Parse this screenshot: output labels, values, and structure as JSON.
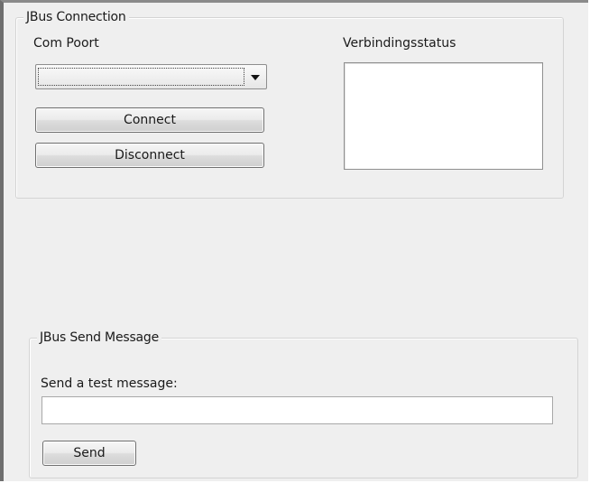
{
  "connection_group": {
    "title": "JBus Connection",
    "com_port_label": "Com Poort",
    "com_port_selected": "",
    "connect_label": "Connect",
    "disconnect_label": "Disconnect",
    "status_label": "Verbindingsstatus",
    "status_items": []
  },
  "send_group": {
    "title": "JBus Send Message",
    "message_label": "Send a test message:",
    "message_value": "",
    "message_placeholder": "",
    "send_label": "Send"
  },
  "colors": {
    "window_bg": "#efefef",
    "group_border": "#d4d4d4",
    "frame_edge": "#6e6e6e"
  }
}
